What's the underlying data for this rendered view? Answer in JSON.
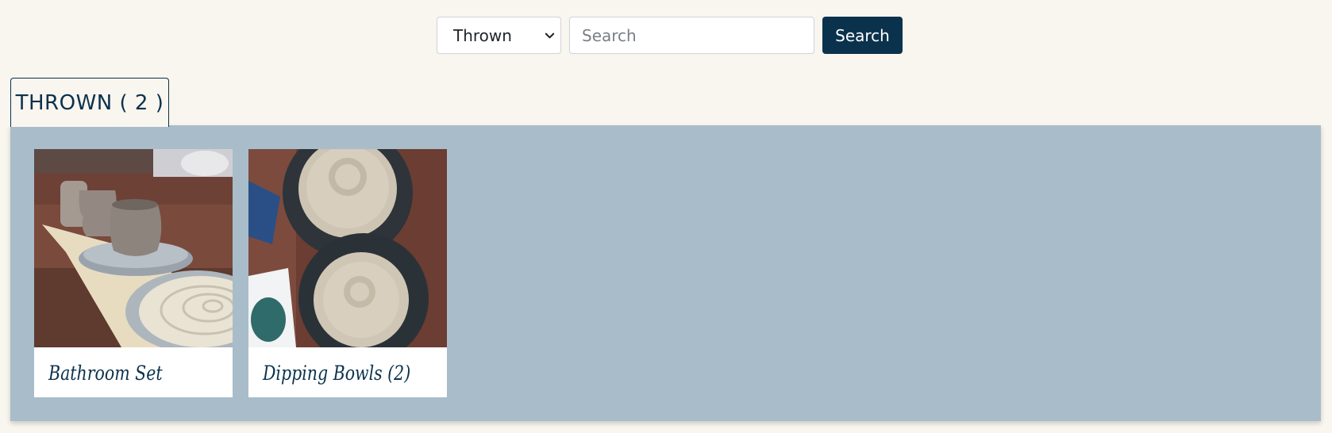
{
  "search": {
    "category_selected": "Thrown",
    "placeholder": "Search",
    "button_label": "Search"
  },
  "tab": {
    "label": "THROWN ( 2 )"
  },
  "gallery": {
    "items": [
      {
        "title": "Bathroom Set"
      },
      {
        "title": "Dipping Bowls (2)"
      }
    ]
  },
  "colors": {
    "background": "#f9f5ef",
    "accent": "#0b324d",
    "panel": "#a8bdc9"
  },
  "icons": {
    "select_arrow": "chevron-down-icon"
  }
}
